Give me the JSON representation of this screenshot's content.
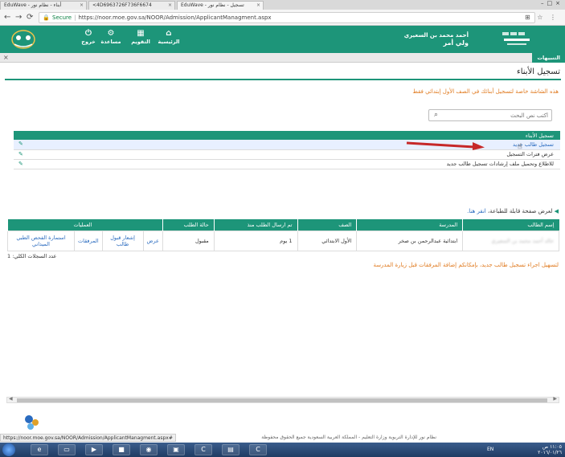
{
  "browser": {
    "tabs": [
      {
        "label": "EduWave - أبناء - نظام نور"
      },
      {
        "label": "<4D6963726F736F6674"
      },
      {
        "label": "EduWave - تسجيل - نظام نور"
      }
    ],
    "secure_label": "Secure",
    "url": "https://noor.moe.gov.sa/NOOR/Admission/ApplicantManagment.aspx"
  },
  "header": {
    "nav": [
      {
        "label": "الرئيسية",
        "icon": "home-icon"
      },
      {
        "label": "التقويم",
        "icon": "calendar-icon"
      },
      {
        "label": "مساعدة",
        "icon": "help-icon"
      },
      {
        "label": "خروج",
        "icon": "power-icon"
      }
    ],
    "user_name": "أحمد محمد بن السعيري",
    "user_role": "ولي أمر"
  },
  "notifications": {
    "label": "التنبيهات"
  },
  "page": {
    "title": "تسجيل الأبناء",
    "notice": "هذه الشاشة خاصة لتسجيل أبنائك في الصف الأول إبتدائي فقط",
    "search_placeholder": "أكتب نص البحث"
  },
  "menu": {
    "header": "تسجيل الأبناء",
    "items": [
      {
        "label": "تسجيل طالب جديد"
      },
      {
        "label": "عرض فترات التسجيل"
      },
      {
        "label": "للاطلاع وتحميل ملف إرشادات تسجيل طالب جديد"
      }
    ]
  },
  "print_link": {
    "text": "لعرض صفحة قابلة للطباعة،",
    "here": "انقر هنا."
  },
  "table": {
    "columns": [
      "إسم الطالب",
      "المدرسة",
      "الصف",
      "تم ارسال الطلب منذ",
      "حالة الطلب",
      "العمليات"
    ],
    "rows": [
      {
        "student": "خالد أحمد محمد بن السعيري",
        "school": "ابتدائية عبدالرحمن بن صخر",
        "grade": "الأول الابتدائي",
        "sent_since": "1 يوم",
        "status": "مقبول",
        "ops": [
          "عرض",
          "إشعار قبول طالب",
          "المرفقات",
          "استمارة الفحص الطبي الميداني"
        ]
      }
    ],
    "total_label": "عدد السجلات الكلي: 1"
  },
  "warning": "لتسهيل اجراء تسجيل طالب جديد، بإمكانكم إضافة المرفقات قبل زيارة المدرسة",
  "status_url": "https://noor.moe.gov.sa/NOOR/Admission/ApplicantManagment.aspx#",
  "copyright": "نظام نور للإدارة التربوية وزارة التعليم - المملكة العربية السعودية جميع الحقوق محفوظة",
  "taskbar": {
    "lang": "EN",
    "time": "١١:٠٥ ص",
    "date": "٢٠١٦/٠١/٢٦"
  }
}
